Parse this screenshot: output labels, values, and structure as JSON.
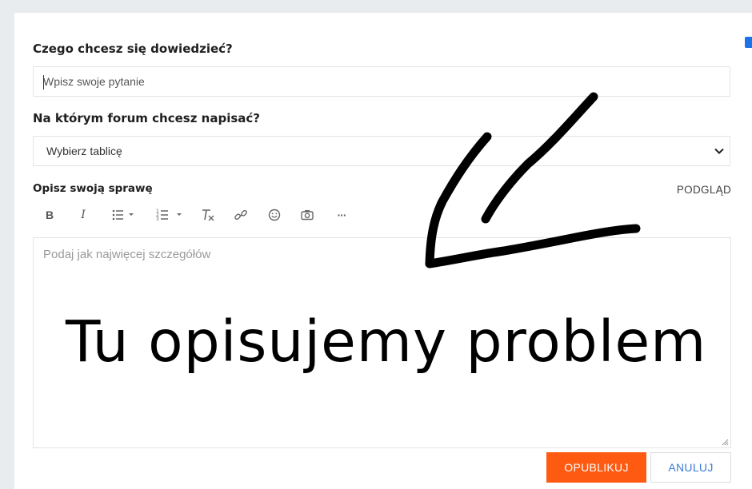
{
  "form": {
    "question_label": "Czego chcesz się dowiedzieć?",
    "question_placeholder": "Wpisz swoje pytanie",
    "forum_label": "Na którym forum chcesz napisać?",
    "forum_selected": "Wybierz tablicę",
    "description_label": "Opisz swoją sprawę",
    "preview_label": "PODGLĄD",
    "editor_placeholder": "Podaj jak najwięcej szczegółów",
    "publish_label": "OPUBLIKUJ",
    "cancel_label": "ANULUJ"
  },
  "toolbar": {
    "bold": "B",
    "italic": "I",
    "more": "···"
  },
  "icons": [
    "bold-icon",
    "italic-icon",
    "bullet-list-icon",
    "numbered-list-icon",
    "clear-format-icon",
    "link-icon",
    "emoji-icon",
    "camera-icon",
    "more-icon",
    "chevron-down-icon"
  ],
  "annotation": {
    "text": "Tu opisujemy problem"
  },
  "colors": {
    "accent": "#ff5a12",
    "link": "#3a7bd5",
    "background": "#e9ecef"
  }
}
